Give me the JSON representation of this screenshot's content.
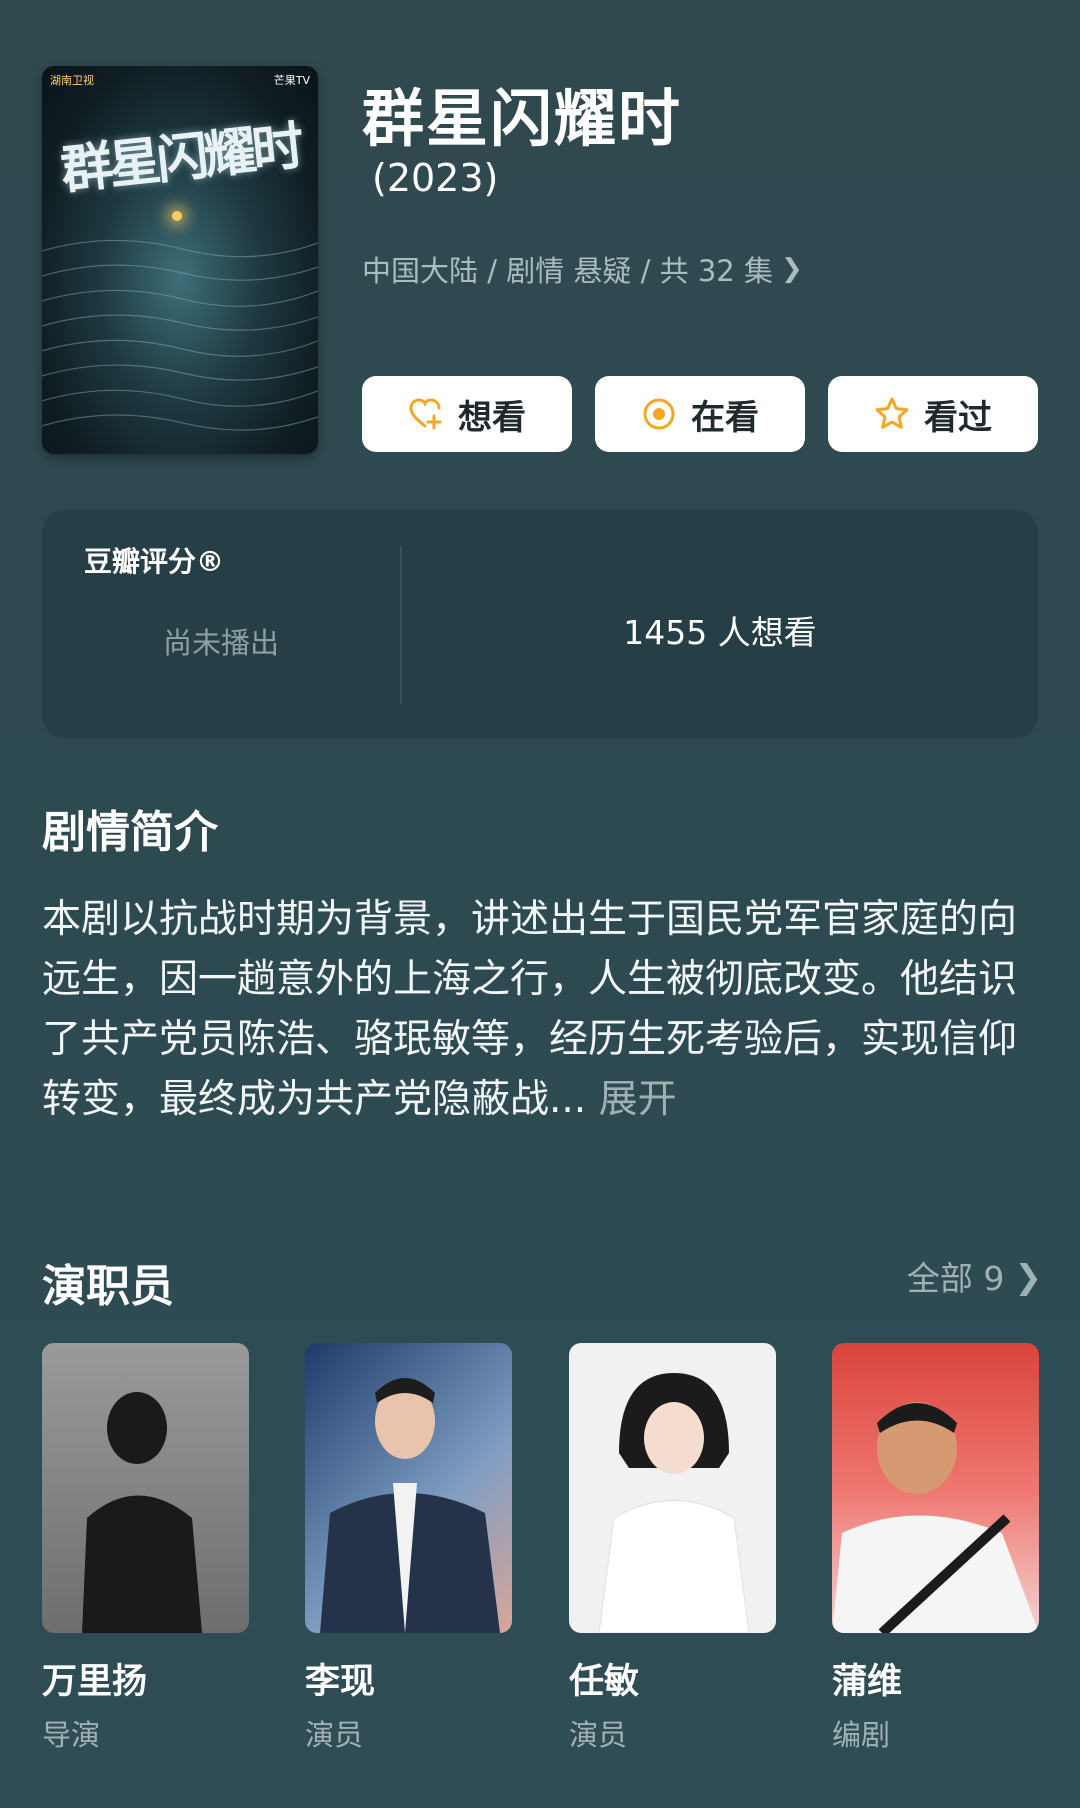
{
  "show": {
    "title": "群星闪耀时",
    "year": "(2023)",
    "meta": "中国大陆 / 剧情 悬疑 / 共 32 集",
    "poster": {
      "title_art": "群星闪耀时",
      "network_left": "湖南卫视",
      "network_right": "芒果TV"
    }
  },
  "actions": {
    "want": "想看",
    "watching": "在看",
    "watched": "看过"
  },
  "rating": {
    "label": "豆瓣评分®",
    "status": "尚未播出",
    "wish_count": "1455 人想看"
  },
  "synopsis": {
    "title": "剧情简介",
    "text": "本剧以抗战时期为背景，讲述出生于国民党军官家庭的向远生，因一趟意外的上海之行，人生被彻底改变。他结识了共产党员陈浩、骆珉敏等，经历生死考验后，实现信仰转变，最终成为共产党隐蔽战...",
    "more": "展开"
  },
  "cast": {
    "title": "演职员",
    "all": "全部 9",
    "members": [
      {
        "name": "万里扬",
        "role": "导演"
      },
      {
        "name": "李现",
        "role": "演员"
      },
      {
        "name": "任敏",
        "role": "演员"
      },
      {
        "name": "蒲维",
        "role": "编剧"
      }
    ]
  },
  "colors": {
    "background": "#2e4a52",
    "card": "#263e45",
    "accent": "#f5a623",
    "muted_text": "#9fb1b5"
  },
  "icons": {
    "want": "heart-plus-icon",
    "watching": "target-circle-icon",
    "watched": "star-outline-icon",
    "chevron": "chevron-right-icon"
  }
}
